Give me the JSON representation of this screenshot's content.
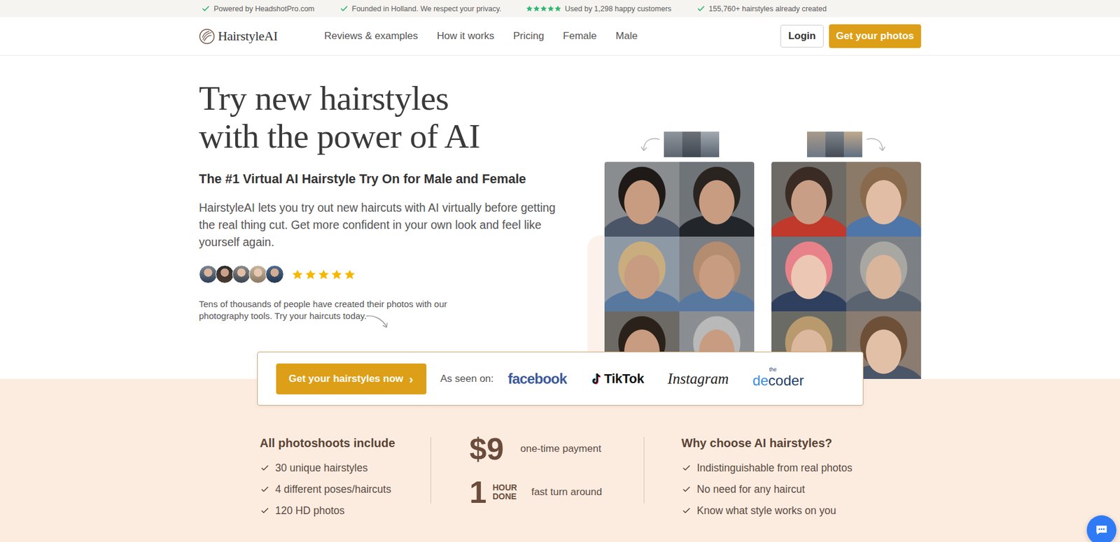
{
  "top_bar": {
    "items": [
      {
        "kind": "check",
        "text": "Powered by HeadshotPro.com"
      },
      {
        "kind": "check",
        "text": "Founded in Holland. We respect your privacy."
      },
      {
        "kind": "stars",
        "stars": 5,
        "text": "Used by 1,298 happy customers"
      },
      {
        "kind": "check",
        "text": "155,760+ hairstyles already created"
      }
    ]
  },
  "nav": {
    "logo": "HairstyleAI",
    "links": [
      "Reviews & examples",
      "How it works",
      "Pricing",
      "Female",
      "Male"
    ],
    "login": "Login",
    "cta": "Get your photos"
  },
  "hero": {
    "title_lines": [
      "Try new hairstyles",
      "with the power of AI"
    ],
    "subtitle": "The #1 Virtual AI Hairstyle Try On for Male and Female",
    "description": "HairstyleAI lets you try out new haircuts with AI virtually before getting the real thing cut. Get more confident in your own look and feel like yourself again.",
    "rating": {
      "stars": 5
    },
    "note": "Tens of thousands of people have created their photos with our photography tools. Try your haircuts today."
  },
  "cta_bar": {
    "button": "Get your hairstyles now",
    "button_icon": "›",
    "seen_on_label": "As seen on:",
    "logos": [
      {
        "kind": "facebook",
        "prefix": "",
        "parts": [
          {
            "text": "facebook",
            "color": "#3b5998"
          }
        ]
      },
      {
        "kind": "tiktok",
        "prefix": "",
        "parts": [
          {
            "text": "TikTok",
            "color": "#111111"
          }
        ]
      },
      {
        "kind": "instagram",
        "prefix": "",
        "parts": [
          {
            "text": "Instagram",
            "color": "#222222"
          }
        ]
      },
      {
        "kind": "decoder",
        "prefix": "the",
        "parts": [
          {
            "text": "de",
            "color": "#3b8ce3"
          },
          {
            "text": "coder",
            "color": "#1e3d6b"
          }
        ]
      }
    ]
  },
  "features": {
    "includes": {
      "title": "All photoshoots include",
      "items": [
        "30 unique hairstyles",
        "4 different poses/haircuts",
        "120 HD photos"
      ]
    },
    "price": {
      "amount": "$9",
      "label": "one-time payment"
    },
    "turnaround": {
      "number": "1",
      "unit_top": "HOUR",
      "unit_bottom": "DONE",
      "label": "fast turn around"
    },
    "why": {
      "title": "Why choose AI hairstyles?",
      "items": [
        "Indistinguishable from real photos",
        "No need for any haircut",
        "Know what style works on you"
      ]
    }
  }
}
